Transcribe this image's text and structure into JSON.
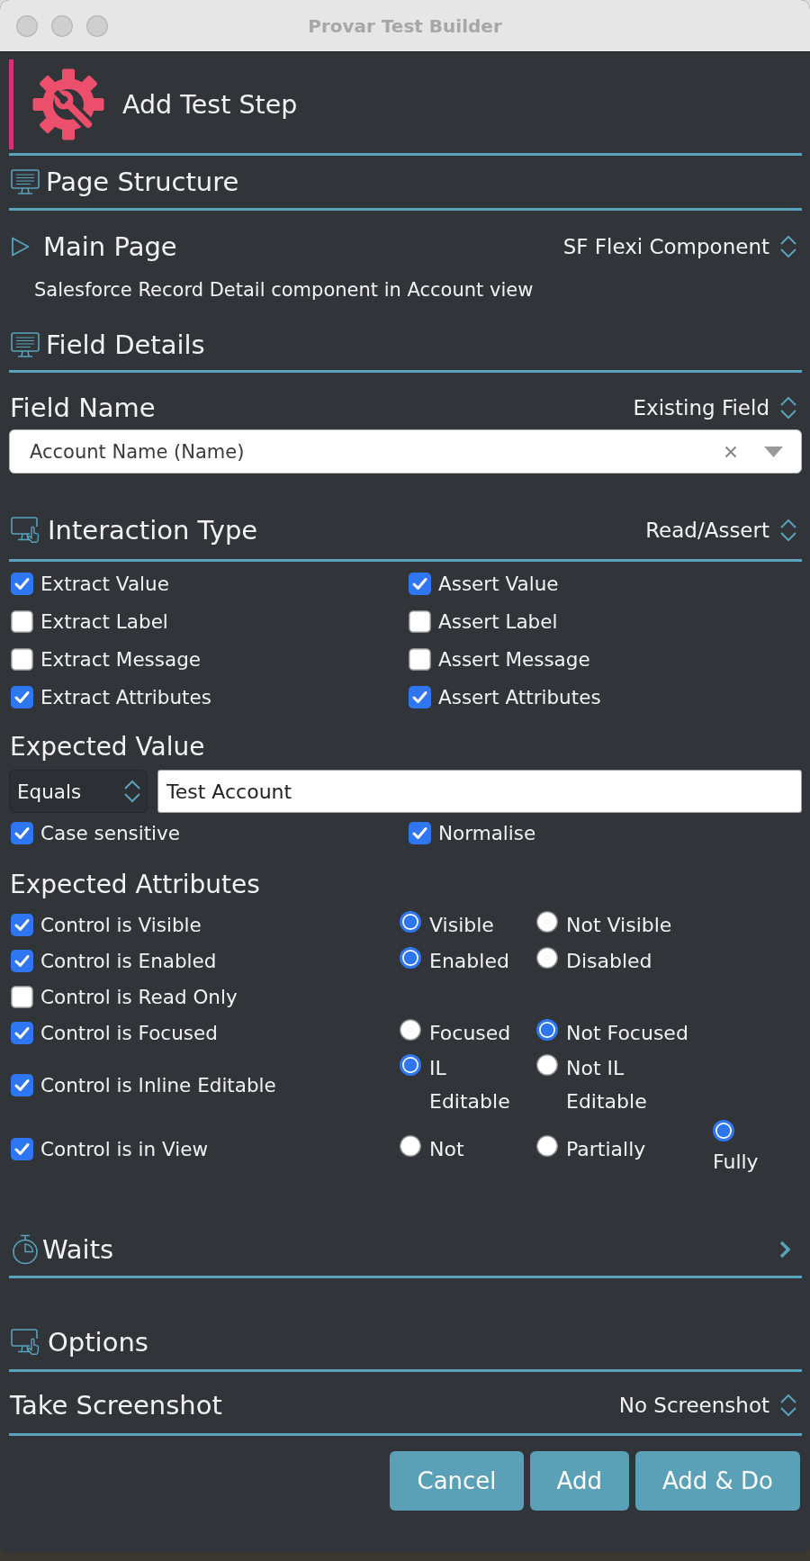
{
  "window": {
    "title": "Provar Test Builder"
  },
  "header": {
    "title": "Add Test Step"
  },
  "page_structure": {
    "title": "Page Structure",
    "page": {
      "name": "Main Page",
      "expanded": false,
      "type": "SF Flexi Component",
      "description": "Salesforce Record Detail component in Account view"
    }
  },
  "field_details": {
    "title": "Field Details",
    "field_name": {
      "label": "Field Name",
      "mode": "Existing Field",
      "value": "Account Name (Name)"
    }
  },
  "interaction_type": {
    "title": "Interaction Type",
    "mode": "Read/Assert",
    "options": [
      {
        "label": "Extract Value",
        "checked": true
      },
      {
        "label": "Assert Value",
        "checked": true
      },
      {
        "label": "Extract Label",
        "checked": false
      },
      {
        "label": "Assert Label",
        "checked": false
      },
      {
        "label": "Extract Message",
        "checked": false
      },
      {
        "label": "Assert Message",
        "checked": false
      },
      {
        "label": "Extract Attributes",
        "checked": true
      },
      {
        "label": "Assert Attributes",
        "checked": true
      }
    ]
  },
  "expected_value": {
    "title": "Expected Value",
    "operator": "Equals",
    "value": "Test Account",
    "options": [
      {
        "label": "Case sensitive",
        "checked": true
      },
      {
        "label": "Normalise",
        "checked": true
      }
    ]
  },
  "expected_attributes": {
    "title": "Expected Attributes",
    "rows": [
      {
        "label": "Control is Visible",
        "checked": true,
        "choices": [
          {
            "label": "Visible",
            "selected": true
          },
          {
            "label": "Not Visible",
            "selected": false
          }
        ]
      },
      {
        "label": "Control is Enabled",
        "checked": true,
        "choices": [
          {
            "label": "Enabled",
            "selected": true
          },
          {
            "label": "Disabled",
            "selected": false
          }
        ]
      },
      {
        "label": "Control is Read Only",
        "checked": false
      },
      {
        "label": "Control is Focused",
        "checked": true,
        "choices": [
          {
            "label": "Focused",
            "selected": false
          },
          {
            "label": "Not Focused",
            "selected": true
          }
        ]
      },
      {
        "label": "Control is Inline Editable",
        "checked": true,
        "choices": [
          {
            "label": "IL Editable",
            "selected": true
          },
          {
            "label": "Not IL Editable",
            "selected": false
          }
        ]
      },
      {
        "label": "Control is in View",
        "checked": true,
        "choices": [
          {
            "label": "Not",
            "selected": false
          },
          {
            "label": "Partially",
            "selected": false
          },
          {
            "label": "Fully",
            "selected": true
          }
        ]
      }
    ]
  },
  "waits": {
    "title": "Waits",
    "expanded": false
  },
  "options": {
    "title": "Options",
    "screenshot": {
      "label": "Take Screenshot",
      "value": "No Screenshot"
    }
  },
  "buttons": [
    "Cancel",
    "Add",
    "Add & Do"
  ]
}
